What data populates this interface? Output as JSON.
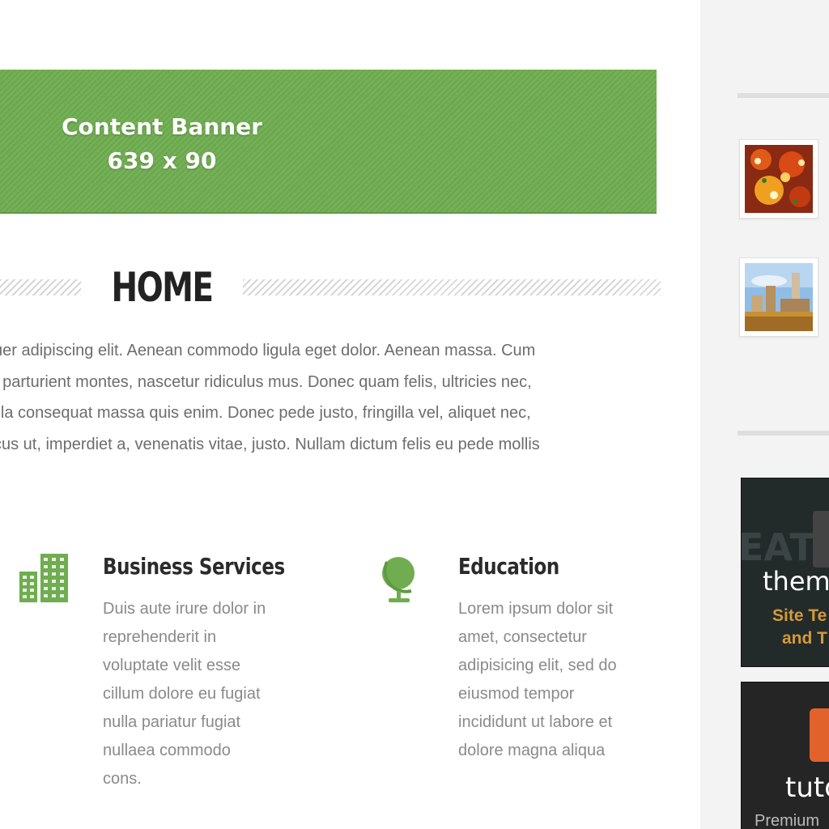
{
  "banner": {
    "line1": "Content Banner",
    "line2": "639 x 90"
  },
  "page": {
    "title": "HOME"
  },
  "intro": {
    "lines": [
      "uer adipiscing elit. Aenean commodo ligula eget dolor. Aenean massa. Cum",
      ", parturient montes, nascetur ridiculus mus. Donec quam felis, ultricies nec,",
      "illa consequat massa quis enim. Donec pede justo, fringilla vel, aliquet nec,",
      "cus ut, imperdiet a, venenatis vitae, justo. Nullam dictum felis eu pede mollis"
    ]
  },
  "features": [
    {
      "icon": "building-icon",
      "title": "Business Services",
      "lines": [
        "Duis aute irure dolor in",
        "reprehenderit in",
        "voluptate velit esse",
        "cillum dolore eu fugiat",
        "nulla pariatur fugiat",
        "nullaea commodo",
        "cons."
      ]
    },
    {
      "icon": "globe-icon",
      "title": "Education",
      "lines": [
        "Lorem ipsum dolor sit",
        "amet, consectetur",
        "adipisicing elit, sed do",
        "eiusmod tempor",
        "incididunt ut labore et",
        "dolore magna aliqua"
      ]
    }
  ],
  "sidebar": {
    "thumbnails": [
      {
        "icon": "pizza-photo"
      },
      {
        "icon": "city-photo"
      }
    ],
    "ads": [
      {
        "bg_text": "EATUR",
        "title": "theme",
        "line1": "Site Te",
        "line2": "and T"
      },
      {
        "title": "tuto",
        "line1": "Premium"
      }
    ]
  },
  "colors": {
    "accent_green": "#6fad50",
    "text_gray": "#6d6d6d",
    "heading_dark": "#222222",
    "sidebar_bg": "#f3f3f3",
    "ad_orange": "#e2622b",
    "ad_gold": "#d39a3a"
  }
}
